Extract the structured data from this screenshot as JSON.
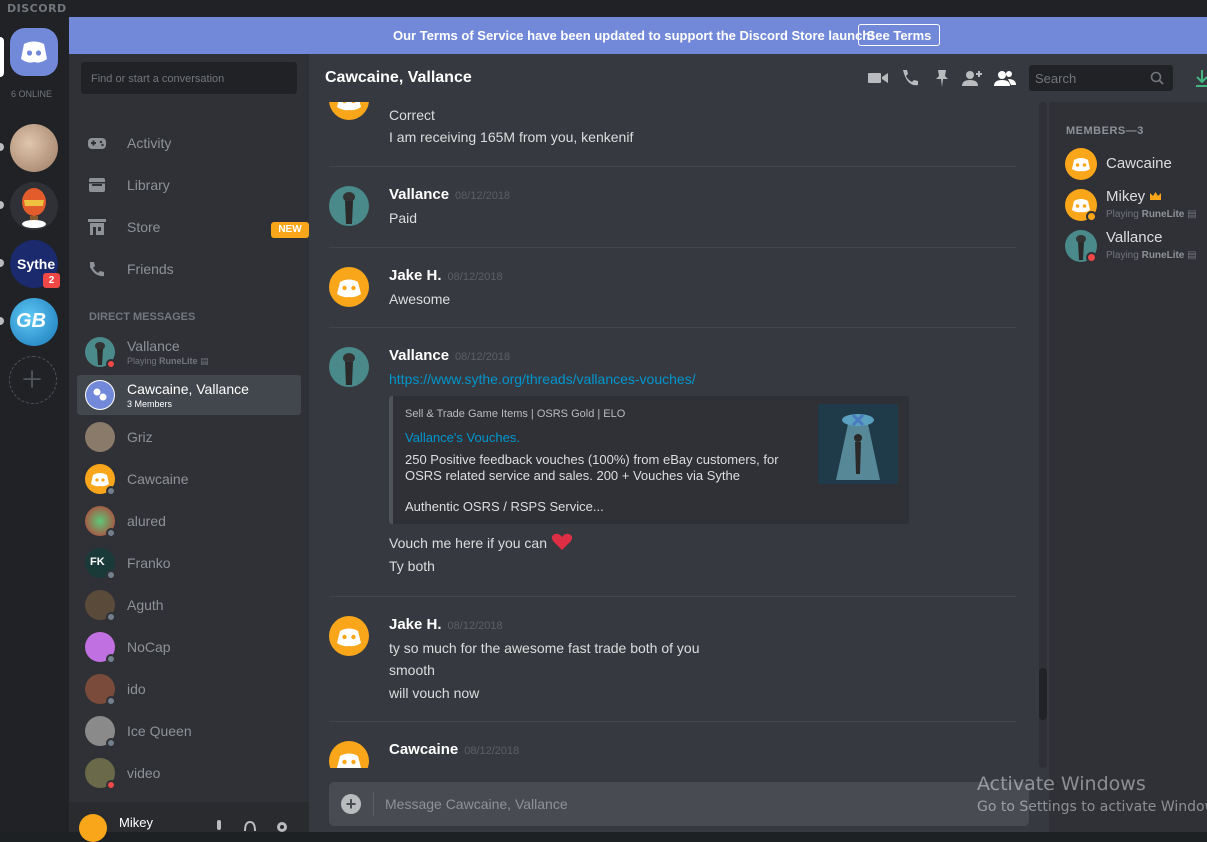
{
  "app": {
    "brand": "DISCORD"
  },
  "guilds": {
    "online_count": "6 ONLINE",
    "badge": "2",
    "sythe_label": "Sythe",
    "gb_label": "GB"
  },
  "banner": {
    "text": "Our Terms of Service have been updated to support the Discord Store launch!",
    "button": "See Terms"
  },
  "dm_sidebar": {
    "search_placeholder": "Find or start a conversation",
    "nav": [
      {
        "label": "Activity"
      },
      {
        "label": "Library"
      },
      {
        "label": "Store",
        "badge": "NEW"
      },
      {
        "label": "Friends"
      }
    ],
    "header": "DIRECT MESSAGES",
    "dms": [
      {
        "name": "Vallance",
        "playing": "Playing",
        "game": "RuneLite"
      },
      {
        "name": "Cawcaine, Vallance",
        "members": "3 Members"
      },
      {
        "name": "Griz"
      },
      {
        "name": "Cawcaine"
      },
      {
        "name": "alured"
      },
      {
        "name": "Franko"
      },
      {
        "name": "Aguth"
      },
      {
        "name": "NoCap"
      },
      {
        "name": "ido"
      },
      {
        "name": "Ice Queen"
      },
      {
        "name": "video"
      }
    ]
  },
  "user_panel": {
    "username": "Mikey"
  },
  "chat_header": {
    "title": "Cawcaine, Vallance",
    "search_placeholder": "Search"
  },
  "messages": [
    {
      "lines": [
        "Correct",
        "I am receiving 165M from you, kenkenif"
      ]
    },
    {
      "author": "Vallance",
      "time": "08/12/2018",
      "lines": [
        "Paid"
      ]
    },
    {
      "author": "Jake H.",
      "time": "08/12/2018",
      "lines": [
        "Awesome"
      ]
    },
    {
      "author": "Vallance",
      "time": "08/12/2018",
      "link": "https://www.sythe.org/threads/vallances-vouches/",
      "embed": {
        "provider": "Sell & Trade Game Items | OSRS Gold | ELO",
        "title": "Vallance's Vouches.",
        "description": "250 Positive feedback vouches (100%) from eBay customers, for OSRS related service and sales. 200 + Vouches via Sythe",
        "footer": "Authentic OSRS / RSPS Service..."
      },
      "lines": [
        "Vouch me here if you can",
        "Ty both"
      ]
    },
    {
      "author": "Jake H.",
      "time": "08/12/2018",
      "lines": [
        "ty so much for the awesome fast trade both of you",
        "smooth",
        "will vouch now"
      ]
    },
    {
      "author": "Cawcaine",
      "time": "08/12/2018",
      "lines": []
    }
  ],
  "input": {
    "placeholder": "Message Cawcaine, Vallance"
  },
  "members": {
    "header": "MEMBERS—3",
    "list": [
      {
        "name": "Cawcaine"
      },
      {
        "name": "Mikey",
        "playing": "Playing",
        "game": "RuneLite"
      },
      {
        "name": "Vallance",
        "playing": "Playing",
        "game": "RuneLite"
      }
    ]
  },
  "overlay": {
    "activate_title": "Activate Windows",
    "activate_sub": "Go to Settings to activate Windows."
  },
  "colors": {
    "blurple": "#7289da",
    "dark": "#202225",
    "sidebar": "#2f3136",
    "chat": "#36393f",
    "orange": "#faa61a",
    "dnd": "#f04747",
    "idle": "#faa61a",
    "offline": "#747f8d",
    "link": "#0096cf"
  }
}
